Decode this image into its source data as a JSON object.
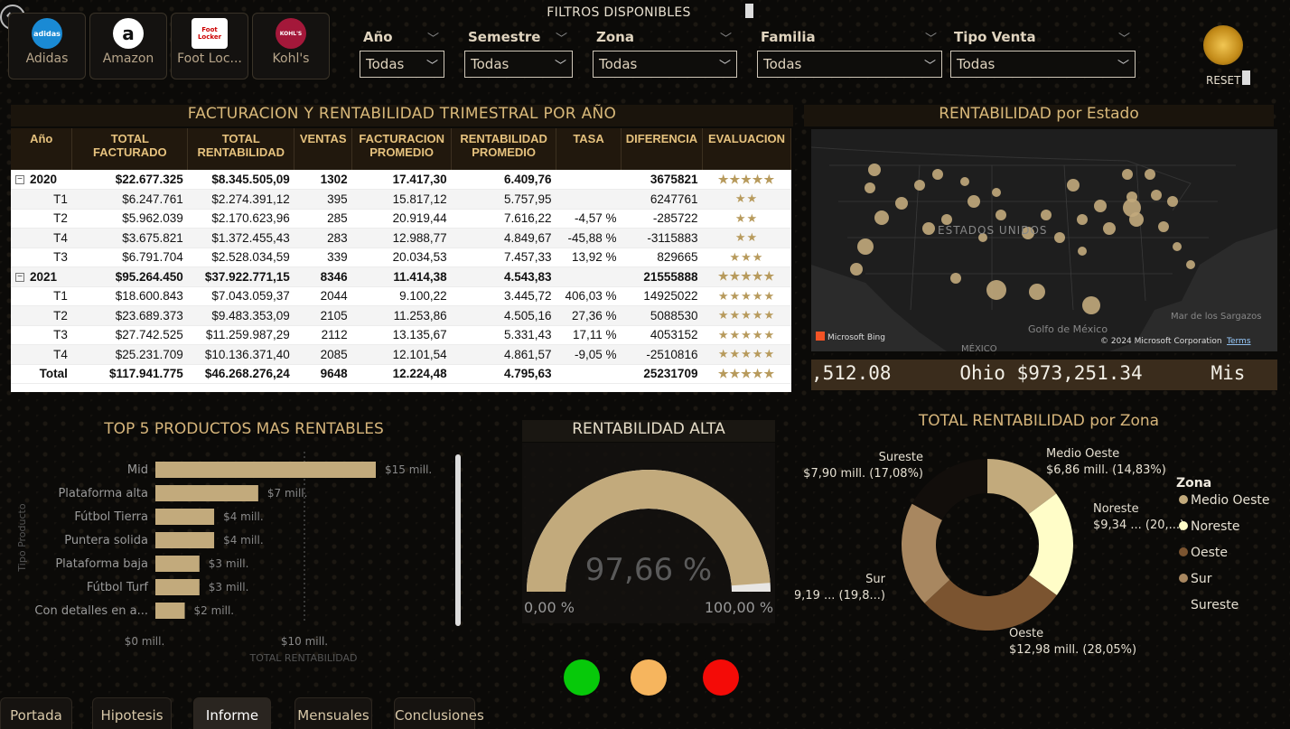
{
  "brands": [
    {
      "label": "Adidas",
      "logo_text": "adidas",
      "color": "#1a8ad4"
    },
    {
      "label": "Amazon",
      "logo_text": "a",
      "color": "#ffffff"
    },
    {
      "label": "Foot Loc...",
      "logo_text": "Foot Locker",
      "color": "#ffffff"
    },
    {
      "label": "Kohl's",
      "logo_text": "KOHL'S",
      "color": "#a4183a"
    }
  ],
  "filters": {
    "title": "FILTROS DISPONIBLES",
    "items": [
      {
        "label": "Año",
        "value": "Todas"
      },
      {
        "label": "Semestre",
        "value": "Todas"
      },
      {
        "label": "Zona",
        "value": "Todas"
      },
      {
        "label": "Familia",
        "value": "Todas"
      },
      {
        "label": "Tipo Venta",
        "value": "Todas"
      }
    ],
    "reset_label": "RESET"
  },
  "table": {
    "title": "FACTURACION Y RENTABILIDAD TRIMESTRAL POR AÑO",
    "headers": [
      "Año",
      "TOTAL FACTURADO",
      "TOTAL RENTABILIDAD",
      "VENTAS",
      "FACTURACION PROMEDIO",
      "RENTABILIDAD PROMEDIO",
      "TASA",
      "DIFERENCIA",
      "EVALUACION"
    ],
    "rows": [
      {
        "type": "grp",
        "cells": [
          "2020",
          "$22.677.325",
          "$8.345.505,09",
          "1302",
          "17.417,30",
          "6.409,76",
          "",
          "3675821",
          "★★★★★"
        ]
      },
      {
        "type": "sub",
        "cells": [
          "T1",
          "$6.247.761",
          "$2.274.391,12",
          "395",
          "15.817,12",
          "5.757,95",
          "",
          "6247761",
          "★★"
        ]
      },
      {
        "type": "sub",
        "cells": [
          "T2",
          "$5.962.039",
          "$2.170.623,96",
          "285",
          "20.919,44",
          "7.616,22",
          "-4,57 %",
          "-285722",
          "★★"
        ]
      },
      {
        "type": "sub",
        "cells": [
          "T4",
          "$3.675.821",
          "$1.372.455,43",
          "283",
          "12.988,77",
          "4.849,67",
          "-45,88 %",
          "-3115883",
          "★★"
        ]
      },
      {
        "type": "sub",
        "cells": [
          "T3",
          "$6.791.704",
          "$2.528.034,59",
          "339",
          "20.034,53",
          "7.457,33",
          "13,92 %",
          "829665",
          "★★★"
        ]
      },
      {
        "type": "grp",
        "cells": [
          "2021",
          "$95.264.450",
          "$37.922.771,15",
          "8346",
          "11.414,38",
          "4.543,83",
          "",
          "21555888",
          "★★★★★"
        ]
      },
      {
        "type": "sub",
        "cells": [
          "T1",
          "$18.600.843",
          "$7.043.059,37",
          "2044",
          "9.100,22",
          "3.445,72",
          "406,03 %",
          "14925022",
          "★★★★★"
        ]
      },
      {
        "type": "sub",
        "cells": [
          "T2",
          "$23.689.373",
          "$9.483.353,09",
          "2105",
          "11.253,86",
          "4.505,16",
          "27,36 %",
          "5088530",
          "★★★★★"
        ]
      },
      {
        "type": "sub",
        "cells": [
          "T3",
          "$27.742.525",
          "$11.259.987,29",
          "2112",
          "13.135,67",
          "5.331,43",
          "17,11 %",
          "4053152",
          "★★★★★"
        ]
      },
      {
        "type": "sub",
        "cells": [
          "T4",
          "$25.231.709",
          "$10.136.371,40",
          "2085",
          "12.101,54",
          "4.861,57",
          "-9,05 %",
          "-2510816",
          "★★★★★"
        ]
      },
      {
        "type": "tot",
        "cells": [
          "Total",
          "$117.941.775",
          "$46.268.276,24",
          "9648",
          "12.224,48",
          "4.795,63",
          "",
          "25231709",
          "★★★★★"
        ]
      }
    ]
  },
  "map": {
    "title": "RENTABILIDAD por Estado",
    "country_label": "ESTADOS UNIDOS",
    "gulf_label": "Golfo de México",
    "mexico_label": "MÉXICO",
    "sargasso_label": "Mar de los Sargazos",
    "bing_label": "Microsoft Bing",
    "copyright": "© 2024 Microsoft Corporation",
    "terms": "Terms",
    "ticker": ",512.08      Ohio $973,251.34      Mis"
  },
  "chart_data": [
    {
      "type": "bar",
      "title": "TOP 5 PRODUCTOS MAS RENTABLES",
      "categories": [
        "Mid",
        "Plataforma alta",
        "Fútbol Tierra",
        "Puntera solida",
        "Plataforma baja",
        "Fútbol Turf",
        "Con detalles en a..."
      ],
      "values": [
        15,
        7,
        4,
        4,
        3,
        3,
        2
      ],
      "data_labels": [
        "$15 mill.",
        "$7 mill.",
        "$4 mill.",
        "$4 mill.",
        "$3 mill.",
        "$3 mill.",
        "$2 mill."
      ],
      "xlabel": "TOTAL RENTABILIDAD",
      "ylabel": "Tipo Producto",
      "xlim": [
        0,
        15
      ],
      "xticks": [
        "$0 mill.",
        "$10 mill."
      ],
      "color": "#c2aa7c"
    },
    {
      "type": "gauge",
      "title": "RENTABILIDAD ALTA",
      "value": 97.66,
      "value_label": "97,66 %",
      "min_label": "0,00 %",
      "max_label": "100,00 %",
      "color": "#c2aa7c"
    },
    {
      "type": "pie",
      "title": "TOTAL RENTABILIDAD por Zona",
      "legend_title": "Zona",
      "series": [
        {
          "name": "Medio Oeste",
          "value": 6.86,
          "label": "$6,86 mill. (14,83%)",
          "color": "#c2aa7c"
        },
        {
          "name": "Noreste",
          "value": 9.34,
          "label": "$9,34 ... (20,...)",
          "color": "#fffdc8"
        },
        {
          "name": "Oeste",
          "value": 12.98,
          "label": "$12,98 mill. (28,05%)",
          "color": "#7b5430"
        },
        {
          "name": "Sur",
          "value": 9.19,
          "label": "$9,19 ... (19,8...)",
          "color": "#a88760"
        },
        {
          "name": "Sureste",
          "value": 7.9,
          "label": "$7,90 mill. (17,08%)",
          "color": "#120e0b"
        }
      ]
    }
  ],
  "lights": {
    "green": "#07c90a",
    "amber": "#f6b55e",
    "red": "#f40b07"
  },
  "tabs": [
    "Portada",
    "Hipotesis",
    "Informe",
    "Mensuales",
    "Conclusiones"
  ],
  "active_tab": "Informe"
}
